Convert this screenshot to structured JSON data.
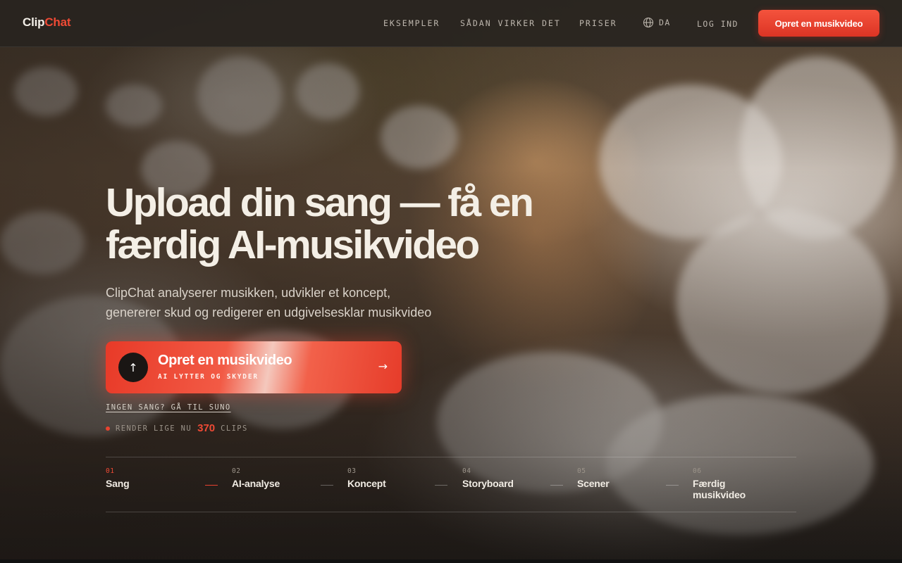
{
  "brand": {
    "name_part1": "Clip",
    "name_part2": "Chat",
    "accent_color": "#ef4a35"
  },
  "nav": {
    "links": [
      {
        "label": "EKSEMPLER"
      },
      {
        "label": "SÅDAN VIRKER DET"
      },
      {
        "label": "PRISER"
      }
    ],
    "language": {
      "icon": "globe-icon",
      "label": "DA"
    },
    "login": "LOG IND",
    "cta": "Opret en musikvideo"
  },
  "hero": {
    "title_line1": "Upload din sang — få en",
    "title_line2": "færdig AI-musikvideo",
    "subtitle_line1": "ClipChat analyserer musikken, udvikler et koncept,",
    "subtitle_line2": "genererer skud og redigerer en udgivelsesklar musikvideo",
    "cta": {
      "icon": "upload-arrow-icon",
      "icon_glyph": "↑",
      "title": "Opret en musikvideo",
      "tagline": "AI LYTTER OG SKYDER",
      "arrow_glyph": "→"
    },
    "secondary_link": "INGEN SANG? GÅ TIL SUNO",
    "render_status": {
      "prefix": "RENDER LIGE NU",
      "count": "370",
      "suffix": "CLIPS"
    }
  },
  "steps": [
    {
      "number": "01",
      "label": "Sang",
      "active": true
    },
    {
      "number": "02",
      "label": "AI-analyse",
      "active": false
    },
    {
      "number": "03",
      "label": "Koncept",
      "active": false
    },
    {
      "number": "04",
      "label": "Storyboard",
      "active": false
    },
    {
      "number": "05",
      "label": "Scener",
      "active": false
    },
    {
      "number": "06",
      "label": "Færdig musikvideo",
      "active": false
    }
  ],
  "colors": {
    "cta_red": "#e63c2a",
    "active_step": "#ef4a35",
    "background": "#2a2520"
  }
}
